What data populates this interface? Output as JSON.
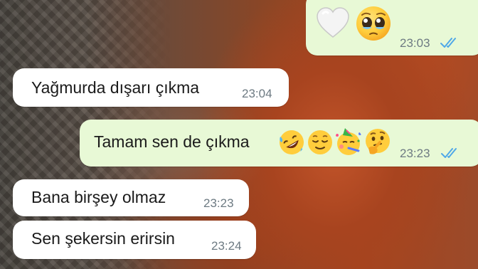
{
  "chat": {
    "messages": [
      {
        "direction": "outgoing",
        "text": "",
        "emoji": [
          "white-heart-icon",
          "pleading-face-icon"
        ],
        "time": "23:03",
        "status": "read"
      },
      {
        "direction": "incoming",
        "text": "Yağmurda dışarı çıkma",
        "time": "23:04"
      },
      {
        "direction": "outgoing",
        "text": "Tamam sen de çıkma",
        "emoji": [
          "rolling-on-floor-laughing-icon",
          "relieved-face-icon",
          "partying-face-icon",
          "thinking-face-icon"
        ],
        "time": "23:23",
        "status": "read"
      },
      {
        "direction": "incoming",
        "text": "Bana birşey olmaz",
        "time": "23:23"
      },
      {
        "direction": "incoming",
        "text": "Sen şekersin erirsin",
        "time": "23:24"
      }
    ]
  },
  "colors": {
    "incoming_bubble": "#ffffff",
    "outgoing_bubble": "#e8f9d6",
    "timestamp": "#6d7a82",
    "read_ticks": "#4fa8e8"
  }
}
